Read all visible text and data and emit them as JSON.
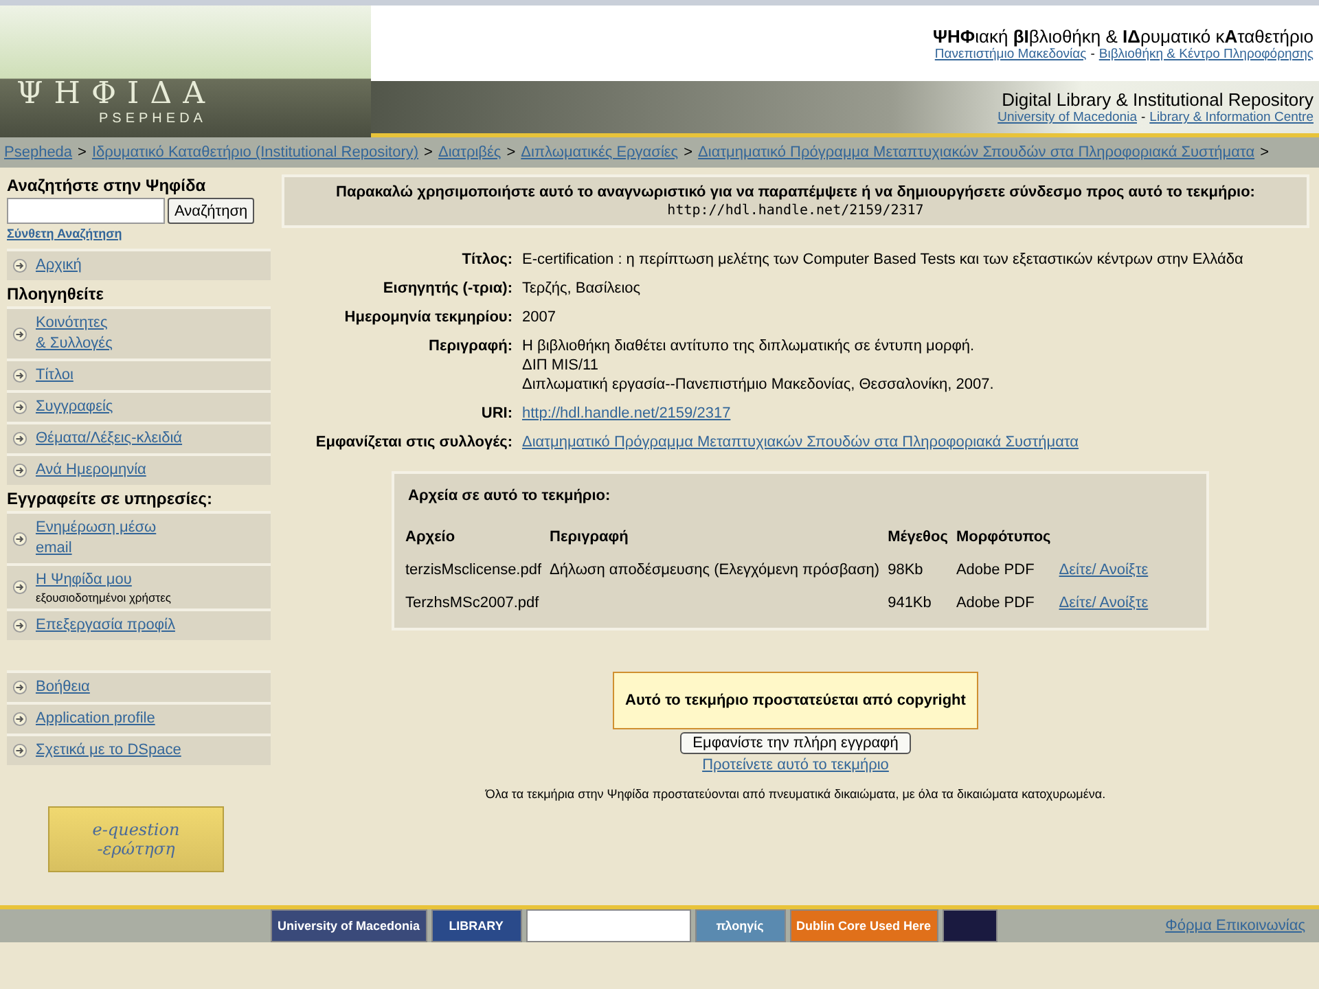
{
  "header": {
    "logo_title": "ΨΗΦΙΔΑ",
    "logo_subtitle": "PSEPHEDA",
    "title_greek": "**ΨΗΦ**ιακή **βΙ**βλιοθήκη & **ΙΔ**ρυματικό κ**Α**ταθετήριο",
    "link_separator": "-",
    "links_greek": [
      "Πανεπιστήμιο Μακεδονίας",
      "Βιβλιοθήκη & Κέντρο Πληροφόρησης"
    ],
    "title_english": "Digital Library & Institutional Repository",
    "links_english": [
      "University of Macedonia",
      "Library & Information Centre"
    ]
  },
  "breadcrumb": {
    "separator": ">",
    "items": [
      "Psepheda",
      "Ιδρυματικό Καταθετήριο (Institutional Repository)",
      "Διατριβές",
      "Διπλωματικές Εργασίες",
      "Διατμηματικό Πρόγραμμα Μεταπτυχιακών Σπουδών στα Πληροφοριακά Συστήματα"
    ]
  },
  "sidebar": {
    "search_heading": "Αναζητήστε στην Ψηφίδα",
    "search_button": "Αναζήτηση",
    "advanced_search": "Σύνθετη Αναζήτηση",
    "groups": [
      {
        "items": [
          {
            "label": "Αρχική"
          }
        ]
      },
      {
        "heading": "Πλοηγηθείτε",
        "items": [
          {
            "lines": [
              "Κοινότητες",
              "& Συλλογές"
            ]
          },
          {
            "label": "Τίτλοι"
          },
          {
            "label": "Συγγραφείς"
          },
          {
            "label": "Θέματα/Λέξεις-κλειδιά"
          },
          {
            "label": "Ανά Ημερομηνία"
          }
        ]
      },
      {
        "heading": "Εγγραφείτε σε υπηρεσίες:",
        "items": [
          {
            "lines": [
              "Ενημέρωση μέσω",
              "email"
            ]
          },
          {
            "label": "Η Ψηφίδα μου",
            "note": "εξουσιοδοτημένοι χρήστες"
          },
          {
            "label": "Επεξεργασία προφίλ"
          }
        ]
      },
      {
        "items": [
          {
            "label": "Βοήθεια"
          },
          {
            "label": "Application profile"
          },
          {
            "label": "Σχετικά με το DSpace"
          }
        ]
      }
    ],
    "badge": [
      "e-question",
      "-ερώτηση"
    ]
  },
  "handle_box": {
    "text": "Παρακαλώ χρησιμοποιήστε αυτό το αναγνωριστικό για να παραπέμψετε ή να δημιουργήσετε σύνδεσμο προς αυτό το τεκμήριο:",
    "url": "http://hdl.handle.net/2159/2317"
  },
  "metadata": [
    {
      "label": "Τίτλος:",
      "lines": [
        "E-certification : η περίπτωση μελέτης των Computer Based Tests και των εξεταστικών κέντρων στην Ελλάδα"
      ]
    },
    {
      "label": "Εισηγητής (-τρια):",
      "lines": [
        "Τερζής, Βασίλειος"
      ]
    },
    {
      "label": "Ημερομηνία τεκμηρίου:",
      "lines": [
        "2007"
      ]
    },
    {
      "label": "Περιγραφή:",
      "lines": [
        "Η βιβλιοθήκη διαθέτει αντίτυπο της διπλωματικής σε έντυπη μορφή.",
        "ΔΙΠ MIS/11",
        "Διπλωματική εργασία--Πανεπιστήμιο Μακεδονίας, Θεσσαλονίκη, 2007."
      ]
    },
    {
      "label": "URI:",
      "link": "http://hdl.handle.net/2159/2317"
    },
    {
      "label": "Εμφανίζεται στις συλλογές:",
      "link": "Διατμηματικό Πρόγραμμα Μεταπτυχιακών Σπουδών στα Πληροφοριακά Συστήματα"
    }
  ],
  "files": {
    "heading": "Αρχεία σε αυτό το τεκμήριο:",
    "columns": [
      "Αρχείο",
      "Περιγραφή",
      "Μέγεθος",
      "Μορφότυπος"
    ],
    "rows": [
      {
        "file": "terzisMsclicense.pdf",
        "description": "Δήλωση αποδέσμευσης (Ελεγχόμενη πρόσβαση)",
        "size": "98Kb",
        "format": "Adobe PDF",
        "action": "Δείτε/ Ανοίξτε"
      },
      {
        "file": "TerzhsMSc2007.pdf",
        "size": "941Kb",
        "format": "Adobe PDF",
        "action": "Δείτε/ Ανοίξτε"
      }
    ]
  },
  "copyright_notice": "Αυτό το τεκμήριο προστατεύεται από copyright",
  "full_record_button": "Εμφανίστε την πλήρη εγγραφή",
  "recommend_link": "Προτείνετε αυτό το τεκμήριο",
  "rights_text": "Όλα τα τεκμήρια στην Ψηφίδα προστατεύονται από πνευματικά δικαιώματα, με όλα τα δικαιώματα κατοχυρωμένα.",
  "footer": {
    "logos": [
      {
        "text": "University of Macedonia",
        "color": "#3a4a7a"
      },
      {
        "text": "LIBRARY",
        "color": "#2a4a8a"
      },
      {
        "color": "#ffffff"
      },
      {
        "text": "πλοηγίς",
        "color": "#5a8ab0"
      },
      {
        "text": "Dublin Core Used Here",
        "color": "#e0701a"
      },
      {
        "color": "#1a1a40"
      }
    ],
    "contact_link": "Φόρμα Επικοινωνίας"
  }
}
